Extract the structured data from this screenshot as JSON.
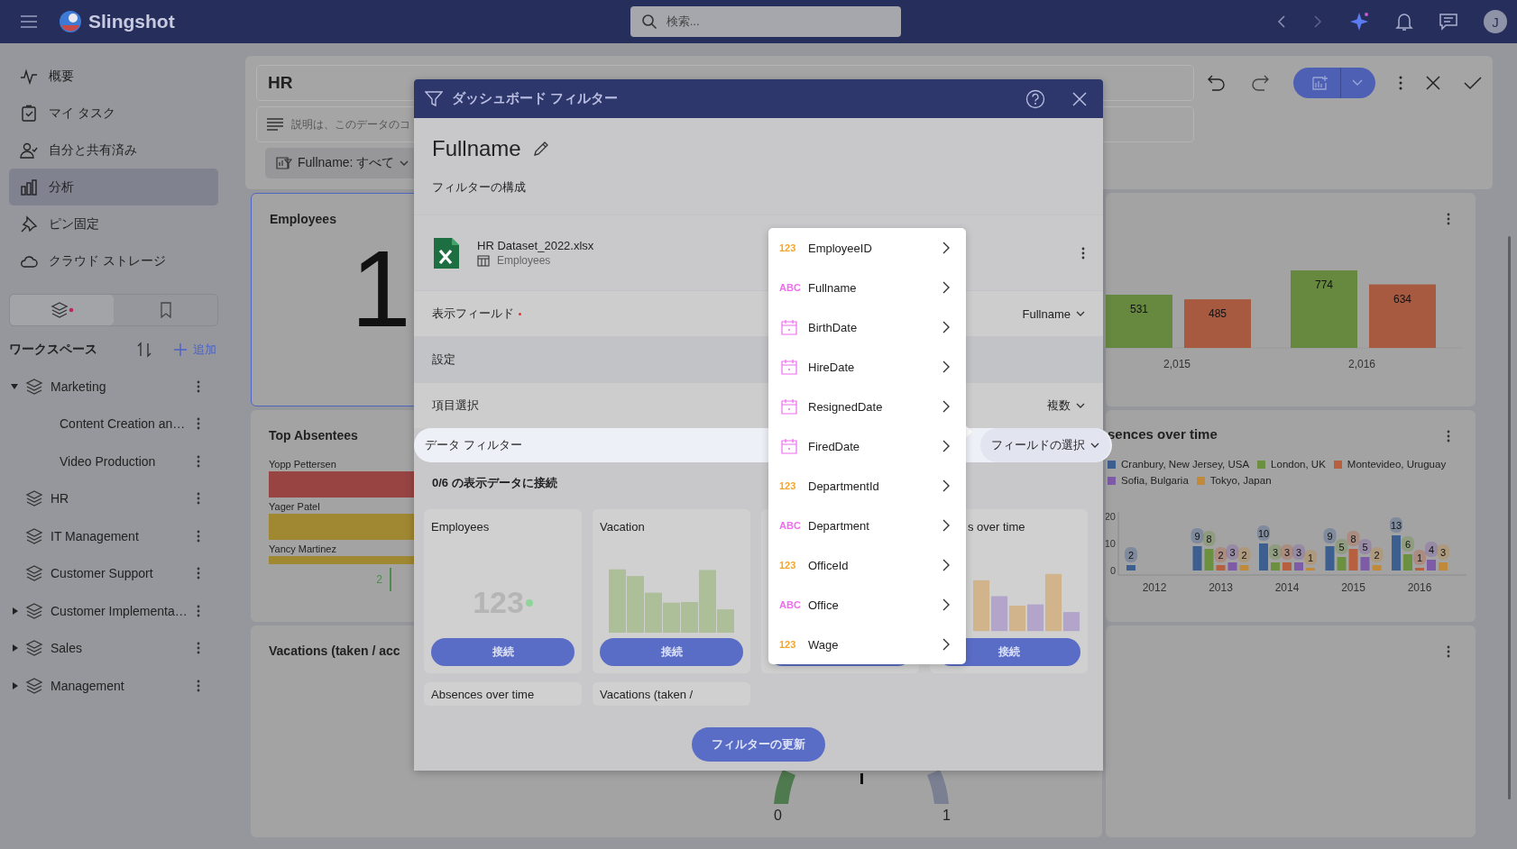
{
  "app": {
    "name": "Slingshot",
    "search_placeholder": "検索...",
    "avatar": "J"
  },
  "nav": [
    {
      "kind": "activity",
      "label": "概要",
      "selected": false
    },
    {
      "kind": "task",
      "label": "マイ タスク",
      "selected": false
    },
    {
      "kind": "shared",
      "label": "自分と共有済み",
      "selected": false
    },
    {
      "kind": "analytics",
      "label": "分析",
      "selected": true
    },
    {
      "kind": "pin",
      "label": "ピン固定",
      "selected": false
    },
    {
      "kind": "cloud",
      "label": "クラウド ストレージ",
      "selected": false
    }
  ],
  "side_tabs": [
    {
      "kind": "layers",
      "selected": true
    },
    {
      "kind": "bookmark",
      "selected": false
    }
  ],
  "workspace": {
    "title": "ワークスペース",
    "add": "追加",
    "items": [
      {
        "label": "Marketing",
        "expanded": true,
        "children": [
          {
            "label": "Content Creation an…"
          },
          {
            "label": "Video Production"
          }
        ]
      },
      {
        "label": "HR"
      },
      {
        "label": "IT Management"
      },
      {
        "label": "Customer Support"
      },
      {
        "label": "Customer Implementa…",
        "expanded": false
      },
      {
        "label": "Sales",
        "expanded": false
      },
      {
        "label": "Management",
        "expanded": false
      }
    ]
  },
  "dashboard": {
    "title": "HR",
    "description_placeholder": "説明は、このデータのコ",
    "filter_chip": "Fullname: すべて"
  },
  "widgets": {
    "employees": {
      "title": "Employees",
      "value": "1",
      "selected": true
    },
    "absentees": {
      "title": "Top Absentees",
      "axis_label": "2",
      "rows": [
        {
          "name": "Yopp Pettersen",
          "color": "#974443"
        },
        {
          "name": "Yager Patel",
          "color": "#a08732"
        },
        {
          "name": "Yancy Martinez",
          "color": "#a08732"
        }
      ]
    },
    "vacations": {
      "title": "Vacations (taken / acc",
      "min_label": "0",
      "max_label": "1"
    },
    "totals": {
      "chart_data": {
        "type": "bar",
        "categories": [
          "2,015",
          "2,016"
        ],
        "data_labels": true,
        "series": [
          {
            "color": "#66883f",
            "values": [
              531,
              774
            ]
          },
          {
            "color": "#a85a40",
            "values": [
              485,
              634
            ]
          }
        ]
      }
    },
    "absences": {
      "title": "sences over time",
      "chart_data": {
        "type": "bar",
        "categories": [
          "2012",
          "2013",
          "2014",
          "2015",
          "2016"
        ],
        "yticks": [
          0,
          10,
          20
        ],
        "ylim": [
          0,
          20
        ],
        "data_labels": true,
        "series": [
          {
            "name": "Cranbury, New Jersey, USA",
            "color": "#3d5f8f",
            "values": [
              2,
              9,
              10,
              9,
              13
            ]
          },
          {
            "name": "London, UK",
            "color": "#6a9040",
            "values": [
              null,
              8,
              3,
              5,
              6
            ]
          },
          {
            "name": "Montevideo, Uruguay",
            "color": "#b6603f",
            "values": [
              null,
              2,
              3,
              8,
              1
            ]
          },
          {
            "name": "Sofia, Bulgaria",
            "color": "#7d5ba6",
            "values": [
              null,
              3,
              3,
              5,
              4
            ]
          },
          {
            "name": "Tokyo, Japan",
            "color": "#c08a3a",
            "values": [
              null,
              2,
              1,
              2,
              3
            ]
          }
        ]
      }
    }
  },
  "dialog": {
    "title": "ダッシュボード フィルター",
    "filter_name": "Fullname",
    "section": "フィルターの構成",
    "source": {
      "file": "HR Dataset_2022.xlsx",
      "table": "Employees"
    },
    "rows": [
      {
        "kind": "select",
        "label": "表示フィールド",
        "required": true,
        "value": "Fullname",
        "selected": false
      },
      {
        "kind": "header",
        "label": "設定",
        "required": false,
        "selected": false
      },
      {
        "kind": "select",
        "label": "項目選択",
        "required": false,
        "value": "複数",
        "selected": false
      },
      {
        "kind": "pill",
        "label": "データ フィルター",
        "required": false,
        "value": "フィールドの選択",
        "selected": true
      }
    ],
    "connect_label": "0/6 の表示データに接続",
    "cards": [
      {
        "kind": "kpi",
        "title": "Employees",
        "preview": "123",
        "button": "接続"
      },
      {
        "kind": "bars",
        "title": "Vacation",
        "color": "#adbf99",
        "button": "接続"
      },
      {
        "kind": "covered"
      },
      {
        "kind": "mixed",
        "title": "s over time",
        "button": "接続"
      }
    ],
    "more_cards": [
      {
        "title": "Absences over time"
      },
      {
        "title": "Vacations (taken /"
      }
    ],
    "update_button": "フィルターの更新"
  },
  "field_menu": [
    {
      "kind": "number",
      "badge": "123",
      "label": "EmployeeID"
    },
    {
      "kind": "text",
      "badge": "ABC",
      "label": "Fullname"
    },
    {
      "kind": "date",
      "label": "BirthDate"
    },
    {
      "kind": "date",
      "label": "HireDate"
    },
    {
      "kind": "date",
      "label": "ResignedDate"
    },
    {
      "kind": "date",
      "label": "FiredDate"
    },
    {
      "kind": "number",
      "badge": "123",
      "label": "DepartmentId"
    },
    {
      "kind": "text",
      "badge": "ABC",
      "label": "Department"
    },
    {
      "kind": "number",
      "badge": "123",
      "label": "OfficeId"
    },
    {
      "kind": "text",
      "badge": "ABC",
      "label": "Office"
    },
    {
      "kind": "number",
      "badge": "123",
      "label": "Wage"
    }
  ]
}
